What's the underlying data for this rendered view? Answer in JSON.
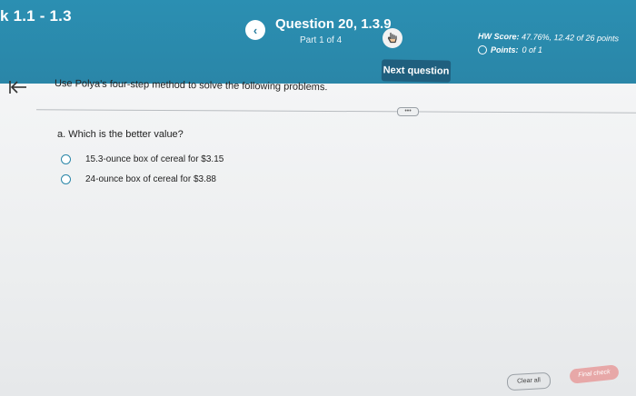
{
  "header": {
    "course_title": "k 1.1 - 1.3",
    "prev_symbol": "‹",
    "question_title": "Question 20, 1.3.9",
    "part": "Part 1 of 4",
    "next_button": "Next question",
    "hw_score_label": "HW Score:",
    "hw_score_value": "47.76%, 12.42 of 26 points",
    "points_label": "Points:",
    "points_value": "0 of 1"
  },
  "main": {
    "instructions": "Use Polya's four-step method to solve the following problems.",
    "more_label": "•••",
    "question": "a. Which is the better value?",
    "options": [
      "15.3-ounce box of cereal for $3.15",
      "24-ounce box of cereal for $3.88"
    ]
  },
  "footer": {
    "clear_all": "Clear all",
    "final_check": "Final check"
  },
  "colors": {
    "header_bg": "#2a86a8",
    "next_button_bg": "#1f5f7e",
    "radio_border": "#2a86a8",
    "final_check_bg": "#e7a8a8"
  },
  "icons": {
    "back": "collapse-left-icon",
    "help": "hand-pointer-icon",
    "points_status": "circle-outline-icon"
  }
}
